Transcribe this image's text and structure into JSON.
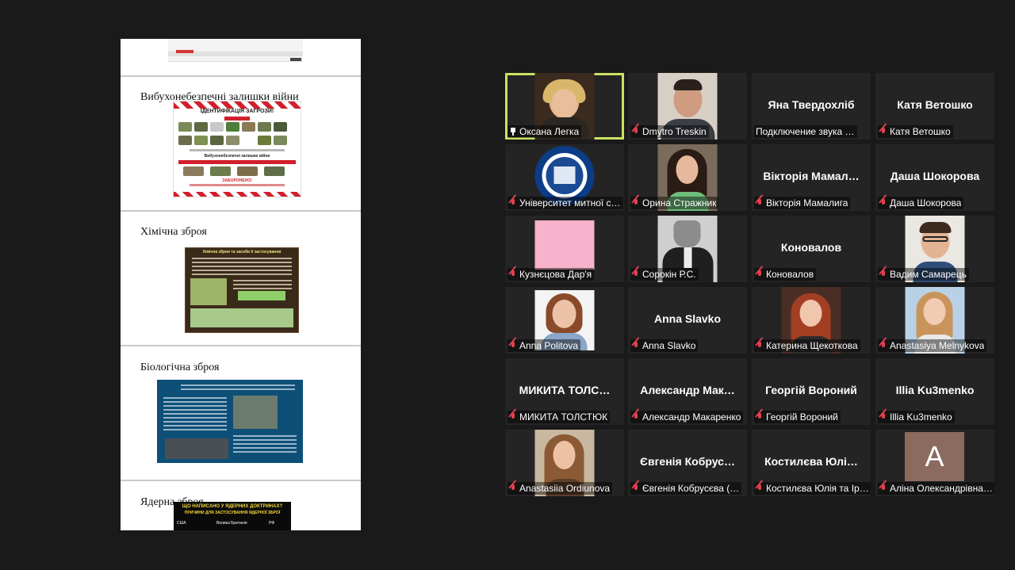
{
  "document": {
    "slides": [
      {
        "title": "Вибухонебезпечні залишки війни",
        "thumb_heading": "ІДЕНТИФІКАЦІЯ ЗАГРОЗИ!",
        "thumb_subheading": "Вибухонебезпечні залишки війни",
        "thumb_footer": "ЗАБОРОНЕНО!"
      },
      {
        "title": "Хімічна зброя",
        "thumb_heading": "Хімічна зброя та засоби її застосування"
      },
      {
        "title": "Біологічна зброя"
      },
      {
        "title": "Ядерна зброя",
        "thumb_heading": "ЩО НАПИСАНО У ЯДЕРНИХ ДОКТРИНАХ?",
        "thumb_subheading": "ПРИЧИНИ ДЛЯ ЗАСТОСУВАННЯ ЯДЕРНОЇ ЗБРОЇ",
        "thumb_flags": [
          "США",
          "Велика Британія",
          "РФ"
        ]
      }
    ]
  },
  "participants": [
    {
      "name": "Оксана Легка",
      "display": "",
      "muted": false,
      "pinned": true,
      "active": true,
      "video": "woman-blonde"
    },
    {
      "name": "Dmytro Treskin",
      "display": "",
      "muted": true,
      "video": "man-dark-hair"
    },
    {
      "name": "Подключение звука …",
      "display": "Яна Твердохліб",
      "muted": false,
      "video": ""
    },
    {
      "name": "Катя Ветошко",
      "display": "Катя Ветошко",
      "muted": true,
      "video": ""
    },
    {
      "name": "Університет митної с…",
      "display": "",
      "muted": true,
      "video": "university-logo"
    },
    {
      "name": "Орина Стражник",
      "display": "",
      "muted": true,
      "video": "girl-dark-hair"
    },
    {
      "name": "Вікторія Мамалига",
      "display": "Вікторія Мамал…",
      "muted": true,
      "video": ""
    },
    {
      "name": "Даша Шокорова",
      "display": "Даша Шокорова",
      "muted": true,
      "video": ""
    },
    {
      "name": "Кузнєцова Дар'я",
      "display": "",
      "muted": true,
      "video": "pink-block"
    },
    {
      "name": "Сорокін Р.С.",
      "display": "",
      "muted": true,
      "video": "cat-suit-bw"
    },
    {
      "name": "Коновалов",
      "display": "Коновалов",
      "muted": true,
      "video": ""
    },
    {
      "name": "Вадим Самарець",
      "display": "",
      "muted": true,
      "video": "boy-glasses"
    },
    {
      "name": "Anna Politova",
      "display": "",
      "muted": true,
      "video": "woman-short-hair"
    },
    {
      "name": "Anna Slavko",
      "display": "Anna Slavko",
      "muted": true,
      "video": ""
    },
    {
      "name": "Катерина Щекоткова",
      "display": "",
      "muted": true,
      "video": "girl-red-hair"
    },
    {
      "name": "Anastasiya Melnykova",
      "display": "",
      "muted": true,
      "video": "girl-light-hair"
    },
    {
      "name": "МИКИТА ТОЛСТЮК",
      "display": "МИКИТА ТОЛС…",
      "muted": true,
      "video": ""
    },
    {
      "name": "Александр Макаренко",
      "display": "Александр Мак…",
      "muted": true,
      "video": ""
    },
    {
      "name": "Георгій Вороний",
      "display": "Георгій Вороний",
      "muted": true,
      "video": ""
    },
    {
      "name": "Illia Ku3menko",
      "display": "Illia Ku3menko",
      "muted": true,
      "video": ""
    },
    {
      "name": "Anastasiia Ordiunova",
      "display": "",
      "muted": true,
      "video": "girl-long-hair"
    },
    {
      "name": "Євгенія Кобрусєва (…",
      "display": "Євгенія Кобрус…",
      "muted": true,
      "video": ""
    },
    {
      "name": "Костилєва Юлія та Ір…",
      "display": "Костилєва Юлі…",
      "muted": true,
      "video": ""
    },
    {
      "name": "Аліна Олександрівна…",
      "display": "",
      "muted": true,
      "video": "avatar-letter",
      "avatar_letter": "А"
    }
  ],
  "colors": {
    "active_border": "#c9e265",
    "mic_muted": "#e0414f",
    "tile_bg": "#242424",
    "app_bg": "#1a1a1a"
  }
}
